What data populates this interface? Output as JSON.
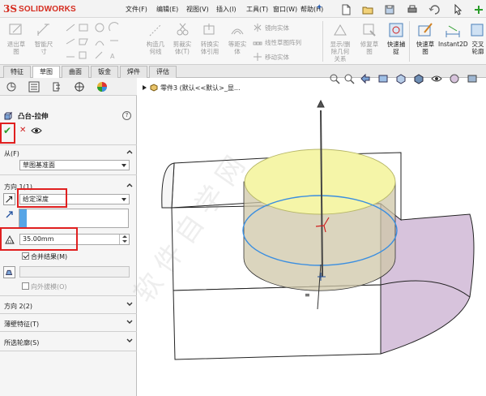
{
  "app": {
    "logo_mark": "3S",
    "logo_name": "SOLIDWORKS",
    "accent_color": "#d52b1e"
  },
  "menu": [
    "文件(F)",
    "编辑(E)",
    "视图(V)",
    "插入(I)",
    "工具(T)",
    "窗口(W)",
    "帮助(H)"
  ],
  "ribbon": {
    "exit_sketch": "退出草\n图",
    "smart_dimension": "智能尺\n寸",
    "construct_geometry": "构造几\n何线",
    "trim_entities": "剪裁实\n体(T)",
    "convert_entities": "转换实\n体引用",
    "offset_entities": "等距实\n体",
    "mirror_entities": "镜向实体",
    "linear_pattern": "线性草图阵列",
    "move_entities": "移动实体",
    "display_relations": "显示/删\n除几何\n关系",
    "repair_sketch": "修复草\n图",
    "quick_snaps": "快速捕\n捉",
    "rapid_sketch": "快速草\n图",
    "instant2d": "Instant2D",
    "shaded_sketch": "交叉\n轮廓"
  },
  "tabs": [
    "特征",
    "草图",
    "曲面",
    "钣金",
    "焊件",
    "评估"
  ],
  "active_tab": "草图",
  "property_manager": {
    "title": "凸台-拉伸",
    "help": "?",
    "from_label": "从(F)",
    "from_value": "草图基准面",
    "direction1_label": "方向 1(1)",
    "end_condition": "给定深度",
    "depth": "35.00mm",
    "merge_result_label": "合并结果(M)",
    "merge_result_checked": true,
    "draft_outward_label": "向外拔模(O)",
    "draft_outward_checked": false,
    "direction2_label": "方向 2(2)",
    "thin_feature_label": "薄壁特征(T)",
    "selected_contours_label": "所选轮廓(S)"
  },
  "viewport": {
    "tree_flyout": "零件3 (默认<<默认>_显...",
    "watermark": "软件自学网"
  },
  "colors": {
    "highlight_box": "#e02020",
    "preview_yellow": "#f5f5a8",
    "sketch_circle": "#3a8ee0",
    "body_face_purple": "#d7c3dc"
  }
}
